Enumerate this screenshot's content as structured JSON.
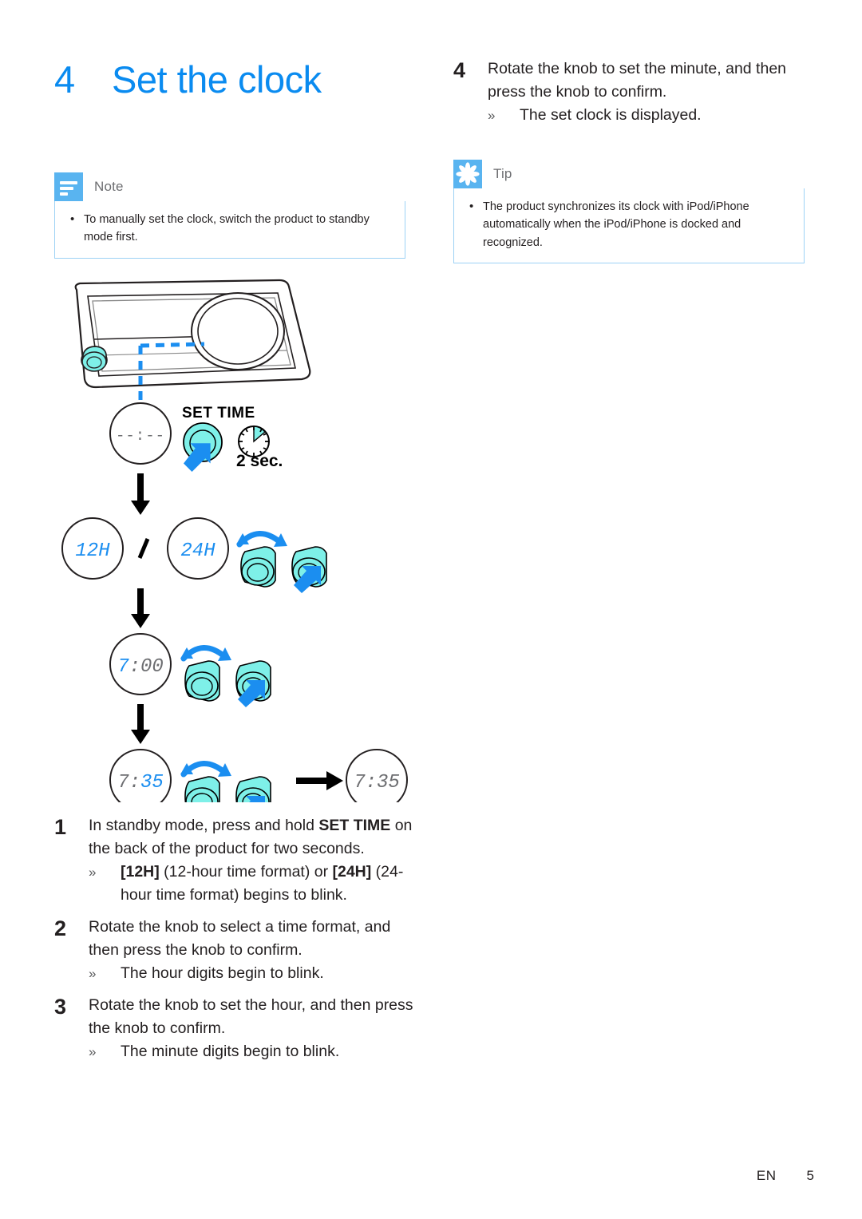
{
  "page": {
    "chapter_number": "4",
    "chapter_title": "Set the clock",
    "footer_language": "EN",
    "footer_page": "5"
  },
  "colors": {
    "brand_blue": "#0a8bf0",
    "callout_badge": "#59b4f0",
    "callout_border": "#9ed2f5",
    "knob_cyan": "#7ef0e8",
    "arrow_blue": "#1b8ef0",
    "display_gray": "#58595b",
    "text": "#231f20"
  },
  "note": {
    "icon": "note-lines-icon",
    "label": "Note",
    "items": [
      "To manually set the clock, switch the product to standby mode first."
    ]
  },
  "tip": {
    "icon": "asterisk-icon",
    "label": "Tip",
    "items": [
      "The product synchronizes its clock with iPod/iPhone automatically when the iPod/iPhone is docked and recognized."
    ]
  },
  "steps_left": [
    {
      "number": "1",
      "text_parts": [
        {
          "t": "In standby mode, press and hold ",
          "b": false
        },
        {
          "t": "SET TIME",
          "b": true
        },
        {
          "t": " on the back of the product for two seconds.",
          "b": false
        }
      ],
      "subs": [
        {
          "marker": "»",
          "parts": [
            {
              "t": "[12H]",
              "b": true
            },
            {
              "t": " (12-hour time format) or ",
              "b": false
            },
            {
              "t": "[24H]",
              "b": true
            },
            {
              "t": " (24-hour time format) begins to blink.",
              "b": false
            }
          ]
        }
      ]
    },
    {
      "number": "2",
      "text_parts": [
        {
          "t": "Rotate the knob to select a time format, and then press the knob to confirm.",
          "b": false
        }
      ],
      "subs": [
        {
          "marker": "»",
          "parts": [
            {
              "t": "The hour digits begin to blink.",
              "b": false
            }
          ]
        }
      ]
    },
    {
      "number": "3",
      "text_parts": [
        {
          "t": "Rotate the knob to set the hour, and then press the knob to confirm.",
          "b": false
        }
      ],
      "subs": [
        {
          "marker": "»",
          "parts": [
            {
              "t": "The minute digits begin to blink.",
              "b": false
            }
          ]
        }
      ]
    }
  ],
  "steps_right": [
    {
      "number": "4",
      "text_parts": [
        {
          "t": "Rotate the knob to set the minute, and then press the knob to confirm.",
          "b": false
        }
      ],
      "subs": [
        {
          "marker": "»",
          "parts": [
            {
              "t": "The set clock is displayed.",
              "b": false
            }
          ]
        }
      ]
    }
  ],
  "diagram": {
    "name": "set-clock-procedure-diagram",
    "device_label": "product-front-panel",
    "rows": [
      {
        "id": "row-set-time",
        "display": "--:--",
        "display_blink": "",
        "button_label": "SET TIME",
        "duration_label": "2 sec.",
        "actions": [
          "press-knob"
        ]
      },
      {
        "id": "row-time-format",
        "display_a": "12H",
        "separator": "/",
        "display_b": "24H",
        "display_blink": "12H / 24H",
        "actions": [
          "rotate-knob",
          "press-knob"
        ]
      },
      {
        "id": "row-set-hour",
        "display": "7:00",
        "display_blink": "7",
        "actions": [
          "rotate-knob",
          "press-knob"
        ]
      },
      {
        "id": "row-set-minute",
        "display": "7:35",
        "display_blink": "35",
        "actions": [
          "rotate-knob",
          "press-knob"
        ],
        "result_display": "7:35"
      }
    ]
  }
}
